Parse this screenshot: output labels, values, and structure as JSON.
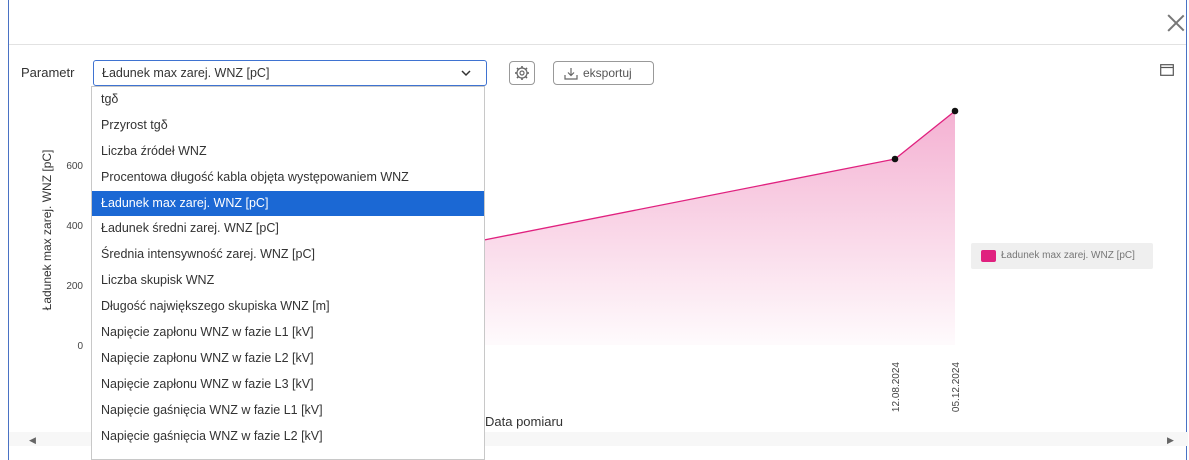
{
  "toolbar": {
    "parameter_label": "Parametr",
    "selected_parameter": "Ładunek max zarej. WNZ [pC]",
    "export_label": "eksportuj"
  },
  "dropdown": {
    "options": [
      "tgδ",
      "Przyrost tgδ",
      "Liczba źródeł WNZ",
      "Procentowa długość kabla objęta występowaniem WNZ",
      "Ładunek max zarej. WNZ [pC]",
      "Ładunek średni zarej. WNZ [pC]",
      "Średnia intensywność zarej. WNZ [pC]",
      "Liczba skupisk WNZ",
      "Długość największego skupiska WNZ [m]",
      "Napięcie zapłonu WNZ w fazie L1 [kV]",
      "Napięcie zapłonu WNZ w fazie L2 [kV]",
      "Napięcie zapłonu WNZ w fazie L3 [kV]",
      "Napięcie gaśnięcia WNZ w fazie L1 [kV]",
      "Napięcie gaśnięcia WNZ w fazie L2 [kV]"
    ],
    "selected_index": 4
  },
  "colors": {
    "series": "#e0217f",
    "selection": "#1b68d4",
    "accent_border": "#3f73d1"
  },
  "chart_data": {
    "type": "area",
    "ylabel": "Ładunek max zarej. WNZ [pC]",
    "xlabel": "Data pomiaru",
    "ylim": [
      0,
      800
    ],
    "yticks": [
      "600",
      "400",
      "200",
      "0"
    ],
    "series": [
      {
        "name": "Ładunek max zarej. WNZ [pC]",
        "points": [
          {
            "x": "12.08.2024",
            "y": 620
          },
          {
            "x": "05.12.2024",
            "y": 780
          }
        ]
      }
    ],
    "legend_position": "right"
  }
}
